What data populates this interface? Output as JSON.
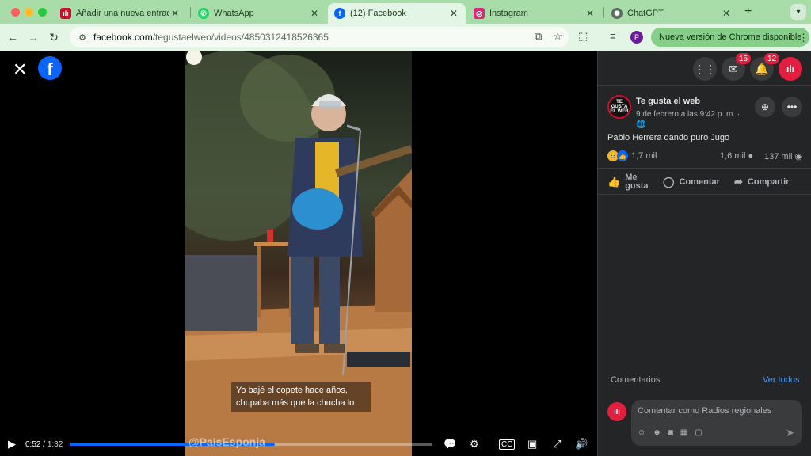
{
  "browser": {
    "tabs": [
      {
        "title": "Añadir una nueva entrada ‹ …",
        "favicon_color": "#c8102e"
      },
      {
        "title": "WhatsApp",
        "favicon_color": "#25d366"
      },
      {
        "title": "(12) Facebook",
        "favicon_color": "#0866ff"
      },
      {
        "title": "Instagram",
        "favicon_color": "#d62976"
      },
      {
        "title": "ChatGPT",
        "favicon_color": "#5f6b60"
      }
    ],
    "url_host": "facebook.com",
    "url_path": "/tegustaelweo/videos/4850312418526365",
    "profile_initial": "P",
    "update_label": "Nueva versión de Chrome disponible"
  },
  "video": {
    "caption_line1": "Yo bajé el copete hace años,",
    "caption_line2": "chupaba más que la chucha lo",
    "watermark": "@PaisEsponja",
    "current_time": "0:52",
    "total_time": "1:32",
    "progress_fraction": 0.565
  },
  "panel": {
    "messenger_badge": "15",
    "notifications_badge": "12",
    "page_name": "Te gusta el web",
    "post_date": "9 de febrero a las 9:42 p. m. ·",
    "post_text": "Pablo Herrera dando puro Jugo",
    "reactions_count": "1,7 mil",
    "comments_count": "1,6 mil",
    "shares_count": "137 mil",
    "action_like_1": "Me",
    "action_like_2": "gusta",
    "action_comment": "Comentar",
    "action_share": "Compartir",
    "comments_heading": "Comentarios",
    "see_all": "Ver todos",
    "composer_placeholder": "Comentar como Radios regionales"
  },
  "icons": {
    "close": "close-icon",
    "facebook": "facebook-logo-icon",
    "play": "play-icon",
    "settings": "gear-icon",
    "volume": "volume-icon"
  }
}
